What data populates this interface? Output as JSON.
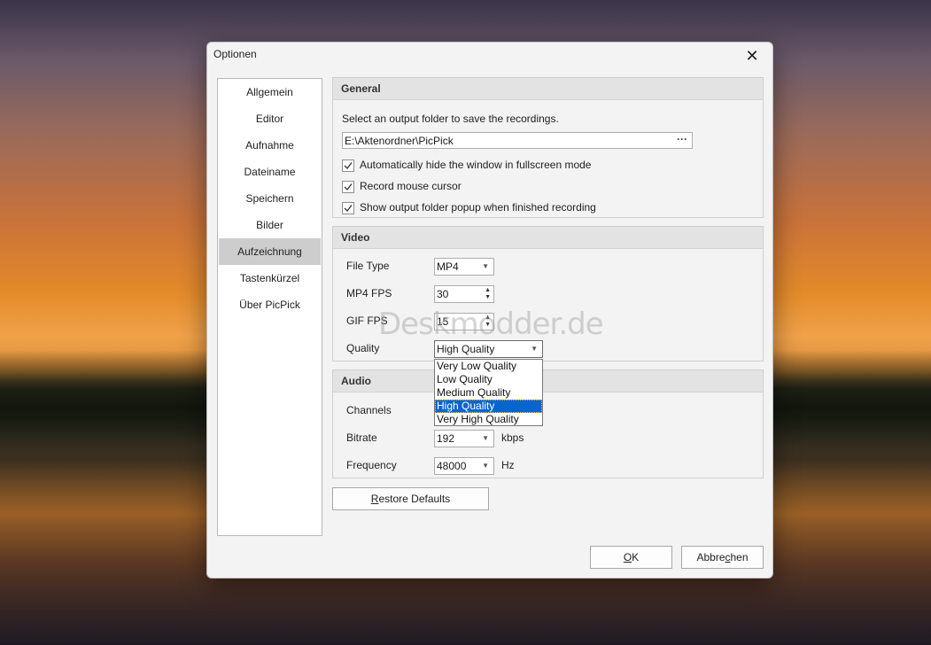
{
  "dialog": {
    "title": "Optionen"
  },
  "nav": {
    "items": [
      {
        "label": "Allgemein"
      },
      {
        "label": "Editor"
      },
      {
        "label": "Aufnahme"
      },
      {
        "label": "Dateiname"
      },
      {
        "label": "Speichern"
      },
      {
        "label": "Bilder"
      },
      {
        "label": "Aufzeichnung",
        "active": true
      },
      {
        "label": "Tastenkürzel"
      },
      {
        "label": "Über PicPick"
      }
    ]
  },
  "general": {
    "header": "General",
    "desc": "Select an output folder to save the recordings.",
    "path": "E:\\Aktenordner\\PicPick",
    "browse": "···",
    "checks": [
      {
        "label": "Automatically hide the window in fullscreen mode",
        "checked": true
      },
      {
        "label": "Record mouse cursor",
        "checked": true
      },
      {
        "label": "Show output folder popup when finished recording",
        "checked": true
      }
    ]
  },
  "video": {
    "header": "Video",
    "file_type_label": "File Type",
    "file_type_value": "MP4",
    "mp4_fps_label": "MP4 FPS",
    "mp4_fps_value": "30",
    "gif_fps_label": "GIF FPS",
    "gif_fps_value": "15",
    "quality_label": "Quality",
    "quality_value": "High Quality",
    "quality_options": [
      "Very Low Quality",
      "Low Quality",
      "Medium Quality",
      "High Quality",
      "Very High Quality"
    ],
    "quality_selected_index": 3
  },
  "audio": {
    "header": "Audio",
    "channels_label": "Channels",
    "bitrate_label": "Bitrate",
    "bitrate_value": "192",
    "bitrate_unit": "kbps",
    "frequency_label": "Frequency",
    "frequency_value": "48000",
    "frequency_unit": "Hz"
  },
  "buttons": {
    "restore": {
      "pre": "",
      "u": "R",
      "post": "estore Defaults"
    },
    "ok": {
      "pre": "",
      "u": "O",
      "post": "K"
    },
    "cancel": {
      "pre": "Abbre",
      "u": "c",
      "post": "hen"
    }
  },
  "watermark": "Deskmodder.de"
}
